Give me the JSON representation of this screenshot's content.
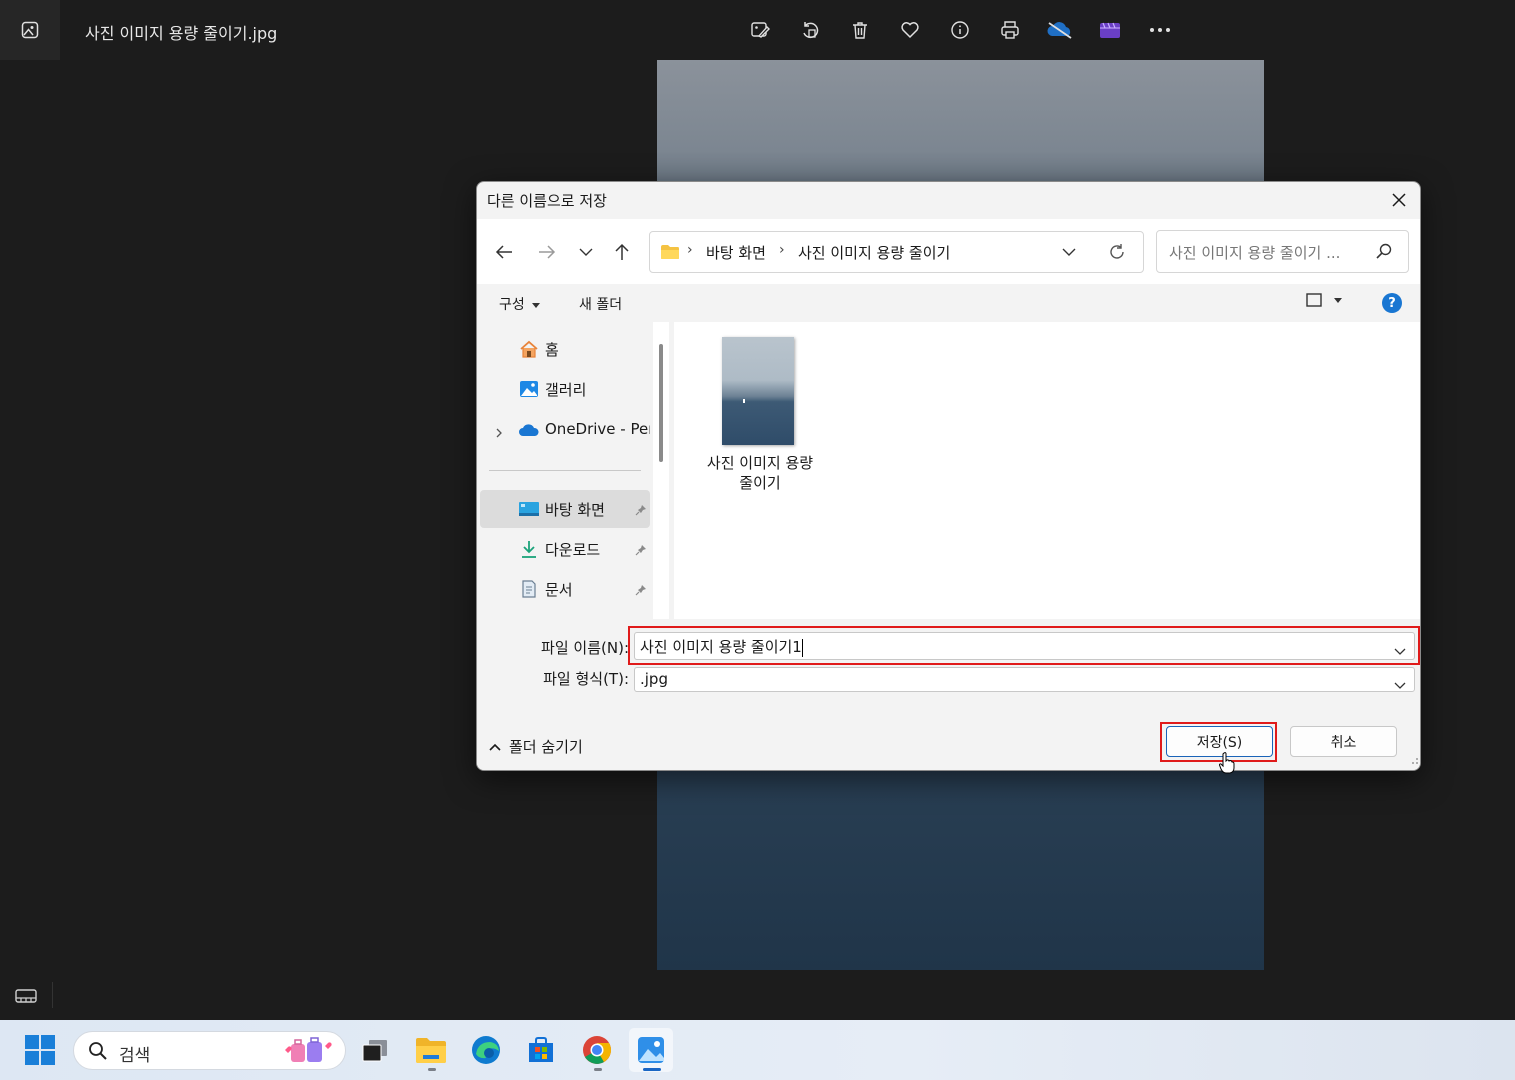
{
  "app": {
    "title": "사진 이미지 용량 줄이기.jpg",
    "toolbar": [
      "edit-image-icon",
      "rotate-icon",
      "delete-icon",
      "favorite-icon",
      "info-icon",
      "print-icon",
      "onedrive-icon",
      "clipchamp-icon",
      "more-icon"
    ]
  },
  "dialog": {
    "title": "다른 이름으로 저장",
    "address": {
      "crumbs": [
        "바탕 화면",
        "사진 이미지 용량 줄이기"
      ],
      "separator": "›"
    },
    "search": {
      "placeholder": "사진 이미지 용량 줄이기 ..."
    },
    "commands": {
      "organize": "구성",
      "new_folder": "새 폴더",
      "help": "?"
    },
    "nav": {
      "home": "홈",
      "gallery": "갤러리",
      "onedrive": "OneDrive - Pers",
      "desktop": "바탕 화면",
      "downloads": "다운로드",
      "documents": "문서"
    },
    "files": [
      {
        "name_line1": "사진 이미지 용량",
        "name_line2": "줄이기"
      }
    ],
    "fields": {
      "filename_label": "파일 이름(N):",
      "filename_value": "사진 이미지 용량 줄이기1",
      "filetype_label": "파일 형식(T):",
      "filetype_value": ".jpg"
    },
    "footer": {
      "hide_folders": "폴더 숨기기",
      "save": "저장(S)",
      "cancel": "취소"
    }
  },
  "taskbar": {
    "search_placeholder": "검색",
    "apps": [
      "task-view",
      "file-explorer",
      "edge",
      "microsoft-store",
      "chrome",
      "photos"
    ]
  },
  "colors": {
    "accent": "#1a66c4",
    "highlight": "#e01a1a",
    "dialog_bg": "#f3f3f3",
    "app_bg": "#1c1c1c"
  }
}
